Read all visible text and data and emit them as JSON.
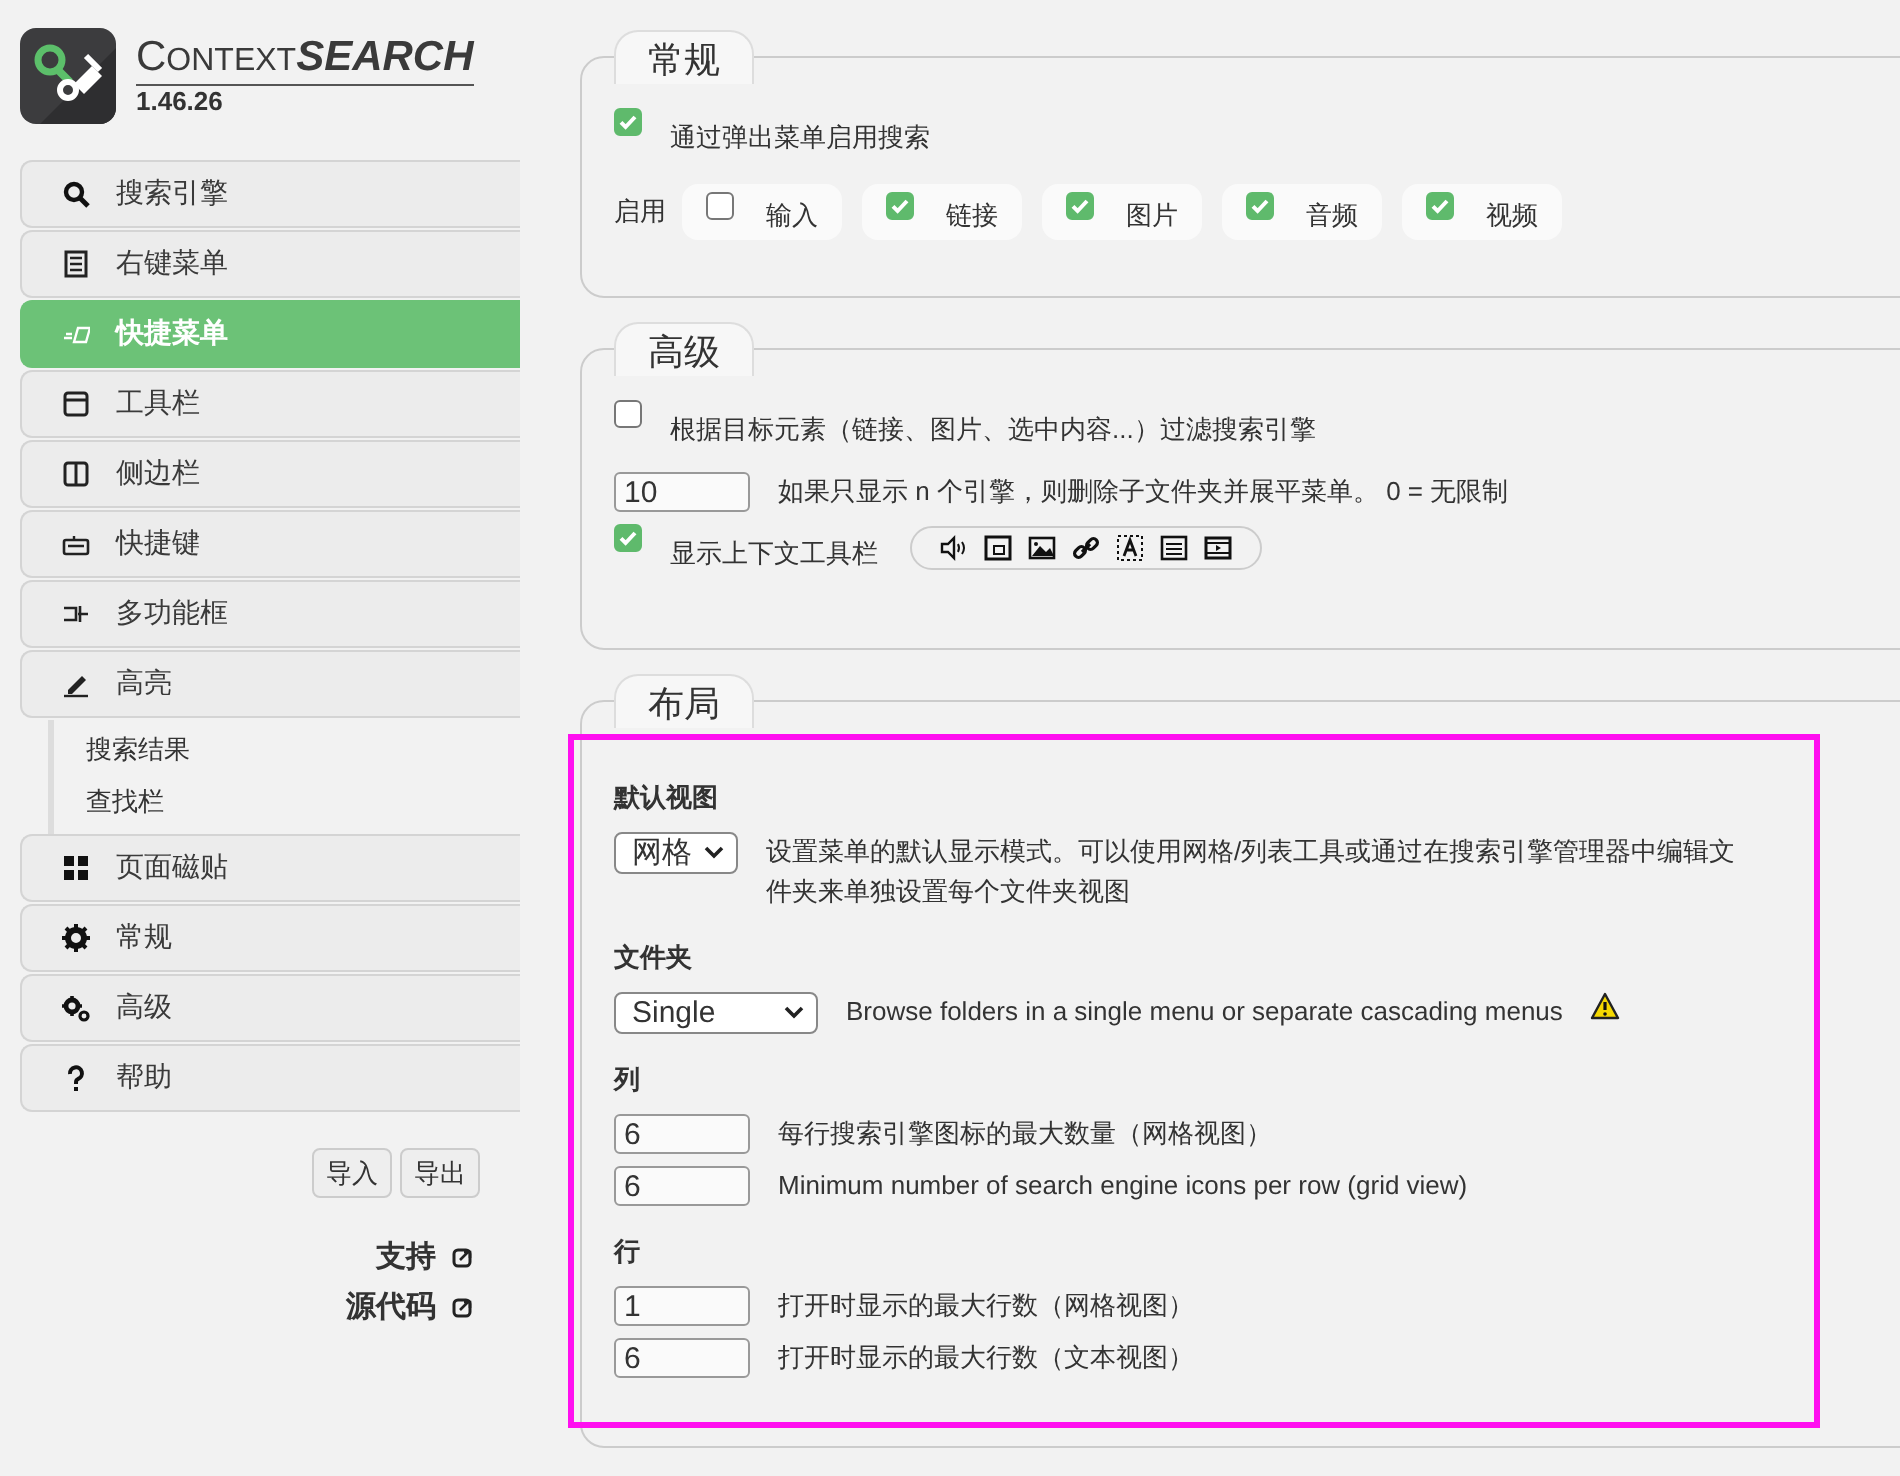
{
  "app": {
    "title": [
      "C",
      "ONTEXT",
      "SEARCH"
    ],
    "version": "1.46.26"
  },
  "nav": [
    {
      "label": "搜索引擎",
      "selected": false
    },
    {
      "label": "右键菜单",
      "selected": false
    },
    {
      "label": "快捷菜单",
      "selected": true
    },
    {
      "label": "工具栏",
      "selected": false
    },
    {
      "label": "侧边栏",
      "selected": false
    },
    {
      "label": "快捷键",
      "selected": false
    },
    {
      "label": "多功能框",
      "selected": false
    },
    {
      "label": "高亮",
      "selected": false,
      "children": [
        {
          "label": "搜索结果"
        },
        {
          "label": "查找栏"
        }
      ]
    },
    {
      "label": "页面磁贴",
      "selected": false
    },
    {
      "label": "常规",
      "selected": false
    },
    {
      "label": "高级",
      "selected": false
    },
    {
      "label": "帮助",
      "selected": false
    }
  ],
  "buttons": [
    "导入",
    "导出"
  ],
  "links": [
    "支持",
    "源代码"
  ],
  "general": {
    "title": "常规",
    "popup_option": {
      "label": "通过弹出菜单启用搜索",
      "checked": true
    },
    "enable_label": "启用",
    "chips": [
      {
        "label": "输入",
        "checked": false
      },
      {
        "label": "链接",
        "checked": true
      },
      {
        "label": "图片",
        "checked": true
      },
      {
        "label": "音频",
        "checked": true
      },
      {
        "label": "视频",
        "checked": true
      }
    ]
  },
  "advanced": {
    "title": "高级",
    "filter_option": {
      "label": "根据目标元素（链接、图片、选中内容...）过滤搜索引擎",
      "checked": false
    },
    "flatten": {
      "value": "10",
      "label": "如果只显示 n 个引擎，则删除子文件夹并展平菜单。 0 = 无限制"
    },
    "toolbar_option": {
      "label": "显示上下文工具栏",
      "checked": true
    }
  },
  "layout": {
    "title": "布局",
    "groups": [
      {
        "heading": "默认视图",
        "rows": [
          {
            "kind": "select",
            "value": "网格",
            "label": "设置菜单的默认显示模式。可以使用网格/列表工具或通过在搜索引擎管理器中编辑文件夹来单独设置每个文件夹视图"
          }
        ]
      },
      {
        "heading": "文件夹",
        "rows": [
          {
            "kind": "select",
            "wide": true,
            "value": "Single",
            "label": "Browse folders in a single menu or separate cascading menus",
            "warning": true
          }
        ]
      },
      {
        "heading": "列",
        "rows": [
          {
            "kind": "number",
            "value": "6",
            "label": "每行搜索引擎图标的最大数量（网格视图）"
          },
          {
            "kind": "number",
            "value": "6",
            "label": "Minimum number of search engine icons per row (grid view)"
          }
        ]
      },
      {
        "heading": "行",
        "rows": [
          {
            "kind": "number",
            "value": "1",
            "label": "打开时显示的最大行数（网格视图）"
          },
          {
            "kind": "number",
            "value": "6",
            "label": "打开时显示的最大行数（文本视图）"
          }
        ]
      }
    ]
  }
}
